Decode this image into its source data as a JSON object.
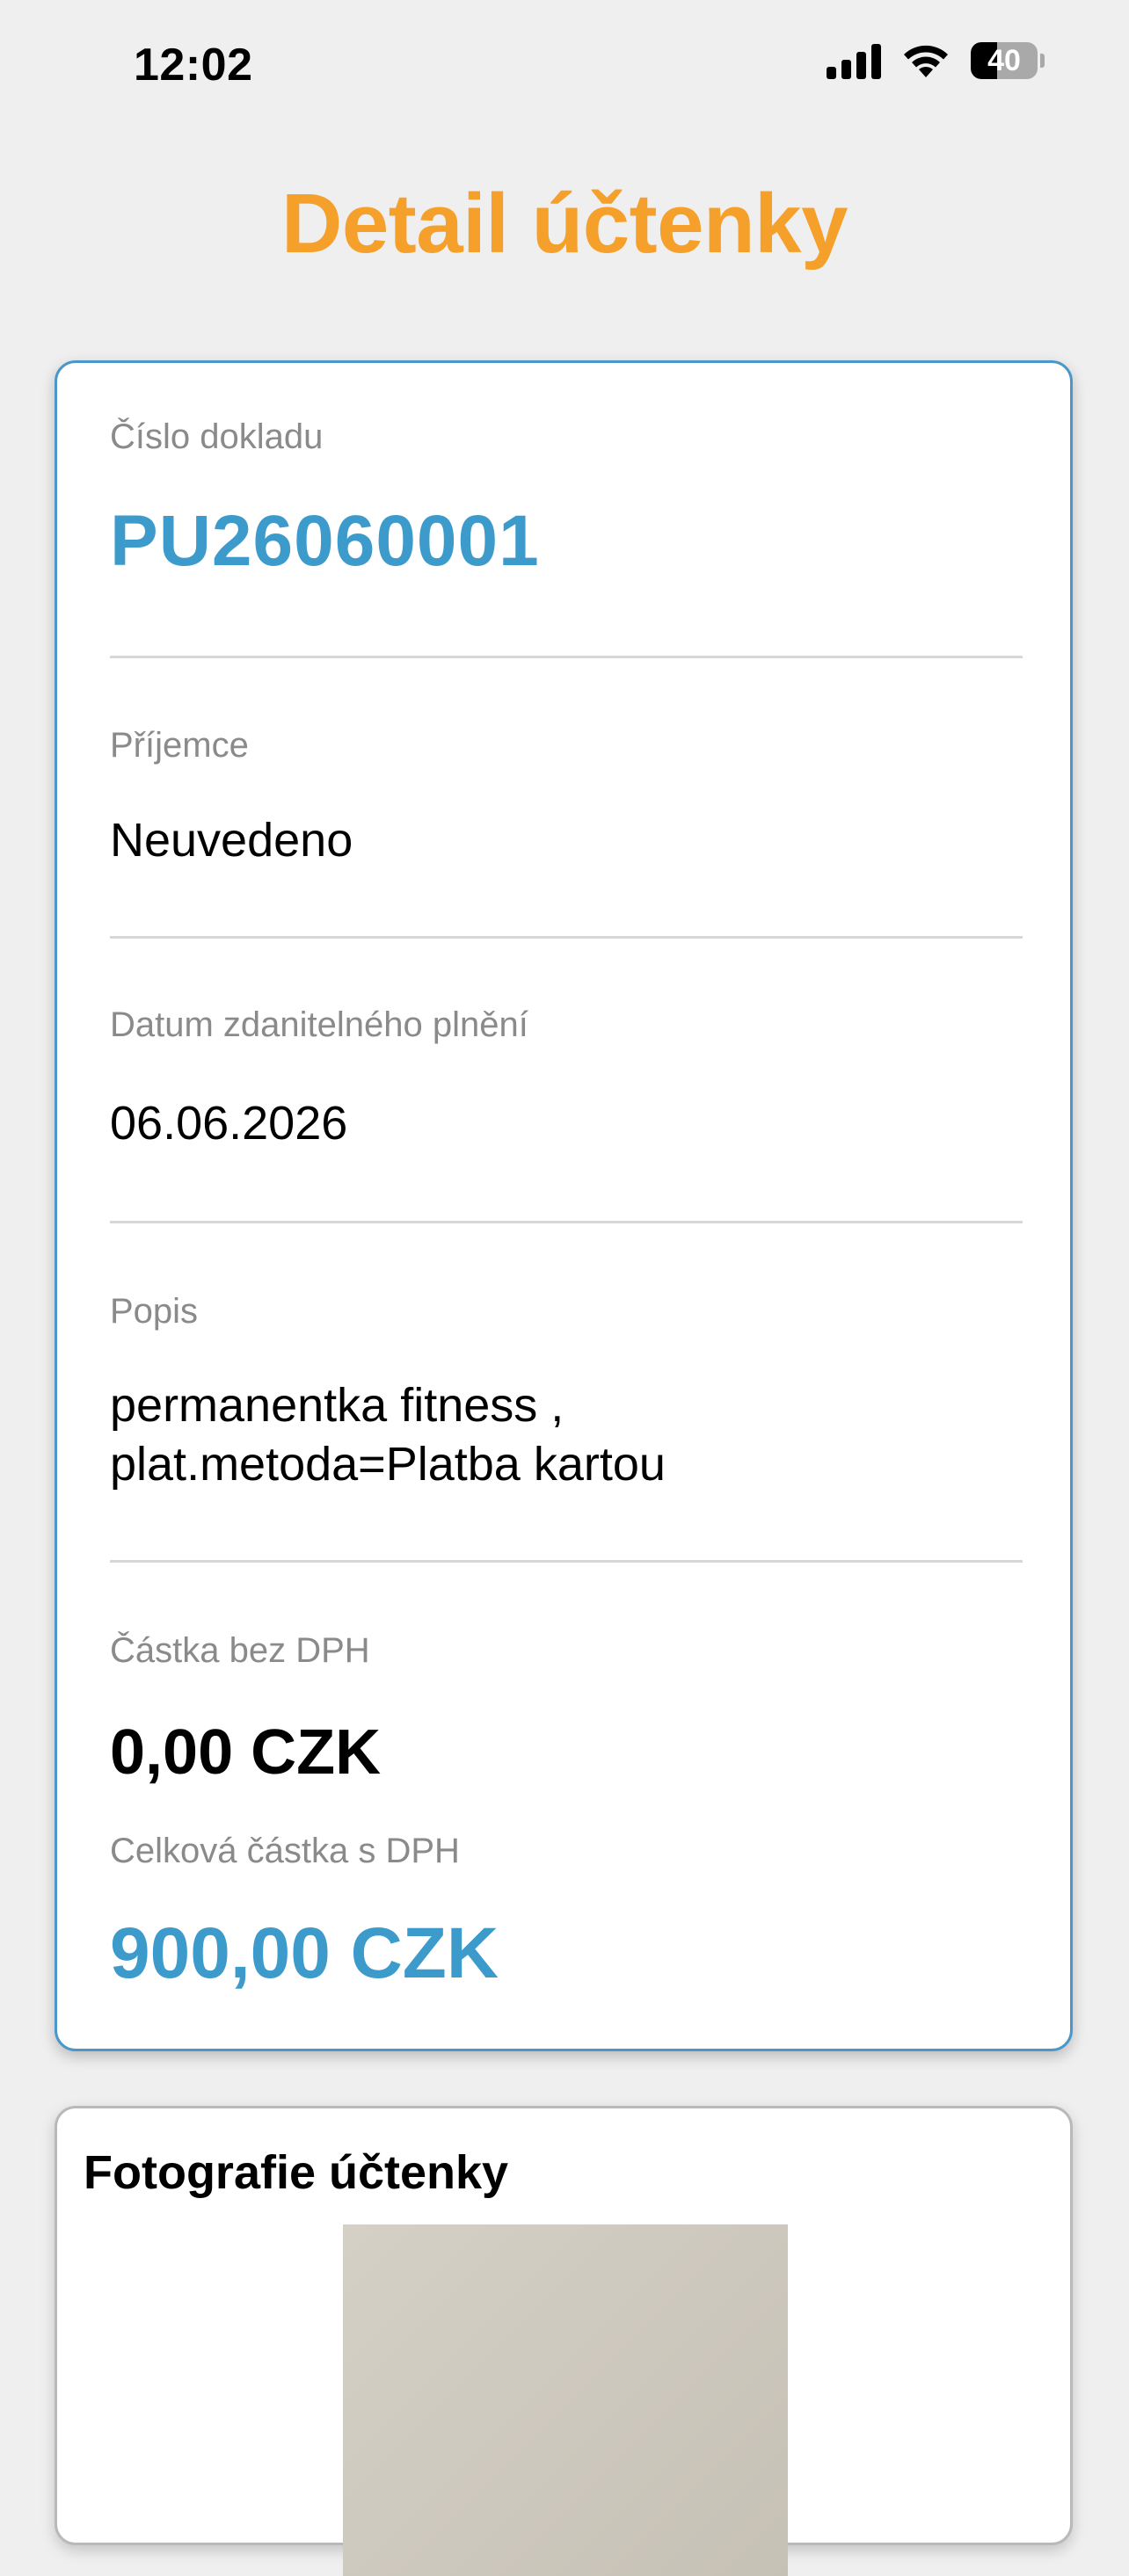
{
  "status_bar": {
    "time": "12:02",
    "battery_percent": "40",
    "battery_level": 0.4,
    "icons": [
      "signal-icon",
      "wifi-icon",
      "battery-icon"
    ]
  },
  "header": {
    "title": "Detail účtenky"
  },
  "receipt": {
    "number_label": "Číslo dokladu",
    "number": "PU26060001",
    "recipient_label": "Příjemce",
    "recipient": "Neuvedeno",
    "date_label": "Datum zdanitelného plnění",
    "date": "06.06.2026",
    "description_label": "Popis",
    "description_line1": "permanentka fitness ,",
    "description_line2": "plat.metoda=Platba kartou",
    "net_label": "Částka bez DPH",
    "net_amount": "0,00 CZK",
    "total_label": "Celková částka s DPH",
    "total_amount": "900,00 CZK"
  },
  "photo_section": {
    "title": "Fotografie účtenky"
  },
  "colors": {
    "accent_orange": "#f5a02b",
    "accent_blue": "#3d9bcc",
    "card_border": "#4a97c9",
    "background": "#efefef"
  }
}
